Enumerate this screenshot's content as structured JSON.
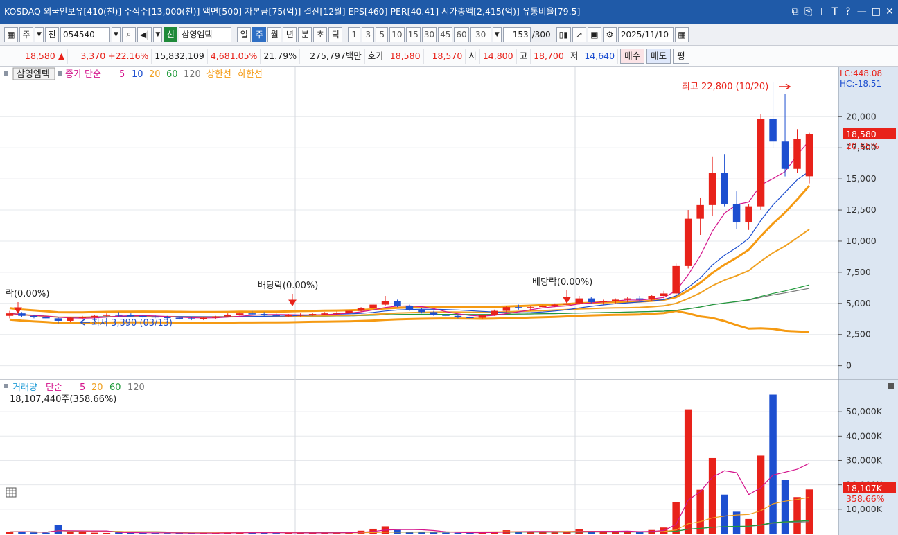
{
  "title_bar": {
    "text": "KOSDAQ 외국인보유[410(천)] 주식수[13,000(천)] 액면[500] 자본금[75(억)] 결산[12월] EPS[460] PER[40.41] 시가총액[2,415(억)] 유통비율[79.5]",
    "icons": [
      "restore-window-icon",
      "new-window-icon",
      "pin-icon",
      "font-icon",
      "help-icon",
      "minimize-icon",
      "maximize-icon",
      "close-icon"
    ],
    "icon_glyphs": [
      "⧉",
      "⎘",
      "⊤",
      "T",
      "?",
      "—",
      "□",
      "✕"
    ]
  },
  "toolbar": {
    "type_label": "주",
    "prev_label": "전",
    "stock_code": "054540",
    "stock_badge": "신",
    "stock_name": "삼영엠텍",
    "period_buttons": [
      "일",
      "주",
      "월",
      "년",
      "분",
      "초",
      "틱"
    ],
    "selected_period": "주",
    "interval_buttons": [
      "1",
      "3",
      "5",
      "10",
      "15",
      "30",
      "45",
      "60"
    ],
    "interval_value": "30",
    "count_value": "153",
    "count_total": "/300",
    "date": "2025/11/10"
  },
  "infobar": {
    "price": "18,580",
    "price_arrow": "▲",
    "change": "3,370",
    "change_pct": "+22.16%",
    "volume": "15,832,109",
    "volume_ratio": "4,681.05%",
    "turnover": "21.79%",
    "trade_value": "275,797백만",
    "quote_label": "호가",
    "ask": "18,580",
    "bid": "18,570",
    "open_label": "시",
    "open": "14,800",
    "high_label": "고",
    "high": "18,700",
    "low_label": "저",
    "low": "14,640",
    "buy_label": "매수",
    "sell_label": "매도",
    "eval_label": "평"
  },
  "price_panel": {
    "legend_name": "삼영엠텍",
    "legend_ma_label": "종가 단순",
    "legend_ma_periods": [
      "5",
      "10",
      "20",
      "60",
      "120"
    ],
    "legend_upper": "상한선",
    "legend_lower": "하한선",
    "lc_text": "LC:448.08",
    "hc_text": "HC:-18.51",
    "high_annotation": "최고 22,800 (10/20)",
    "low_annotation": "최저 3,390 (03/13)",
    "dividend_labels": [
      "락(0.00%)",
      "배당락(0.00%)",
      "배당락(0.00%)"
    ],
    "current_price_label": "18,580",
    "current_pct_label": "20.65%",
    "y_ticks": [
      "20,000",
      "17,500",
      "15,000",
      "12,500",
      "10,000",
      "7,500",
      "5,000",
      "2,500",
      "0"
    ]
  },
  "volume_panel": {
    "legend_name": "거래량",
    "legend_ma_label": "단순",
    "legend_ma_periods": [
      "5",
      "20",
      "60",
      "120"
    ],
    "current_volume_text": "18,107,440주(358.66%)",
    "current_volume_label": "18,107K",
    "current_pct_label": "358.66%",
    "y_ticks": [
      "50,000K",
      "40,000K",
      "30,000K",
      "20,000K",
      "10,000K"
    ]
  },
  "colors": {
    "up": "#e8221a",
    "down": "#1d4fd0",
    "ma5": "#d4148c",
    "ma10": "#1d4fd0",
    "ma20": "#f0a020",
    "ma60": "#1f9a3a",
    "ma120": "#777777",
    "envelope": "#f59a12"
  },
  "chart_data": {
    "type": "candlestick",
    "price_ylim": [
      -800,
      22800
    ],
    "volume_ylim_k": [
      0,
      58000
    ],
    "weekly_ohlc": [
      [
        4000,
        4400,
        3800,
        4200
      ],
      [
        4200,
        4300,
        3900,
        4000
      ],
      [
        4000,
        4100,
        3800,
        3900
      ],
      [
        3900,
        4000,
        3700,
        3800
      ],
      [
        3800,
        3900,
        3390,
        3600
      ],
      [
        3600,
        3900,
        3500,
        3850
      ],
      [
        3850,
        4000,
        3700,
        3900
      ],
      [
        3900,
        4100,
        3800,
        4000
      ],
      [
        4000,
        4200,
        3900,
        4100
      ],
      [
        4100,
        4300,
        3950,
        4050
      ],
      [
        4050,
        4200,
        3900,
        4000
      ],
      [
        4000,
        4100,
        3850,
        3950
      ],
      [
        3950,
        4050,
        3800,
        3900
      ],
      [
        3900,
        4000,
        3750,
        3850
      ],
      [
        3850,
        3950,
        3700,
        3800
      ],
      [
        3800,
        3900,
        3650,
        3750
      ],
      [
        3750,
        3900,
        3650,
        3850
      ],
      [
        3850,
        4000,
        3750,
        3950
      ],
      [
        3950,
        4200,
        3900,
        4100
      ],
      [
        4100,
        4300,
        4000,
        4200
      ],
      [
        4200,
        4400,
        4100,
        4150
      ],
      [
        4150,
        4300,
        4000,
        4100
      ],
      [
        4100,
        4200,
        3950,
        4000
      ],
      [
        4000,
        4150,
        3900,
        4050
      ],
      [
        4050,
        4200,
        3950,
        4100
      ],
      [
        4100,
        4250,
        4000,
        4150
      ],
      [
        4150,
        4300,
        4050,
        4200
      ],
      [
        4200,
        4350,
        4100,
        4250
      ],
      [
        4250,
        4500,
        4150,
        4400
      ],
      [
        4400,
        4700,
        4300,
        4600
      ],
      [
        4600,
        5000,
        4500,
        4900
      ],
      [
        4900,
        5600,
        4800,
        5200
      ],
      [
        5200,
        5300,
        4700,
        4800
      ],
      [
        4800,
        4900,
        4400,
        4500
      ],
      [
        4500,
        4600,
        4200,
        4300
      ],
      [
        4300,
        4400,
        4000,
        4100
      ],
      [
        4100,
        4200,
        3900,
        4000
      ],
      [
        4000,
        4100,
        3800,
        3900
      ],
      [
        3900,
        4000,
        3700,
        3850
      ],
      [
        3850,
        4100,
        3750,
        4050
      ],
      [
        4050,
        4500,
        4000,
        4400
      ],
      [
        4400,
        4800,
        4300,
        4700
      ],
      [
        4700,
        4900,
        4500,
        4600
      ],
      [
        4600,
        4800,
        4400,
        4700
      ],
      [
        4700,
        4900,
        4600,
        4800
      ],
      [
        4800,
        5000,
        4700,
        4900
      ],
      [
        4900,
        5100,
        4800,
        5000
      ],
      [
        5000,
        5600,
        4900,
        5400
      ],
      [
        5400,
        5500,
        5000,
        5100
      ],
      [
        5100,
        5300,
        4900,
        5200
      ],
      [
        5200,
        5400,
        5000,
        5300
      ],
      [
        5300,
        5500,
        5100,
        5400
      ],
      [
        5400,
        5600,
        5200,
        5300
      ],
      [
        5300,
        5700,
        5200,
        5600
      ],
      [
        5600,
        6000,
        5400,
        5800
      ],
      [
        5800,
        8200,
        5700,
        8000
      ],
      [
        8000,
        12500,
        7800,
        11800
      ],
      [
        11800,
        13500,
        10500,
        12900
      ],
      [
        12900,
        16800,
        12000,
        15500
      ],
      [
        15500,
        17000,
        12800,
        13000
      ],
      [
        13000,
        14000,
        11000,
        11500
      ],
      [
        11500,
        13000,
        10900,
        12800
      ],
      [
        12800,
        20200,
        12500,
        19800
      ],
      [
        19800,
        22800,
        17500,
        18000
      ],
      [
        18000,
        21800,
        15200,
        15800
      ],
      [
        15800,
        19000,
        15500,
        18200
      ],
      [
        15210,
        18700,
        14640,
        18580
      ]
    ],
    "weekly_volume_k": [
      700,
      900,
      500,
      400,
      3500,
      700,
      600,
      400,
      300,
      500,
      400,
      300,
      250,
      200,
      250,
      200,
      300,
      250,
      400,
      500,
      350,
      300,
      250,
      300,
      400,
      350,
      300,
      400,
      600,
      1200,
      2000,
      3000,
      1500,
      800,
      600,
      500,
      400,
      350,
      300,
      500,
      800,
      1400,
      900,
      700,
      600,
      500,
      700,
      1800,
      900,
      800,
      700,
      900,
      800,
      1500,
      2500,
      13000,
      51000,
      18000,
      31000,
      16000,
      9000,
      6000,
      32000,
      57000,
      22000,
      15000,
      18107
    ]
  }
}
